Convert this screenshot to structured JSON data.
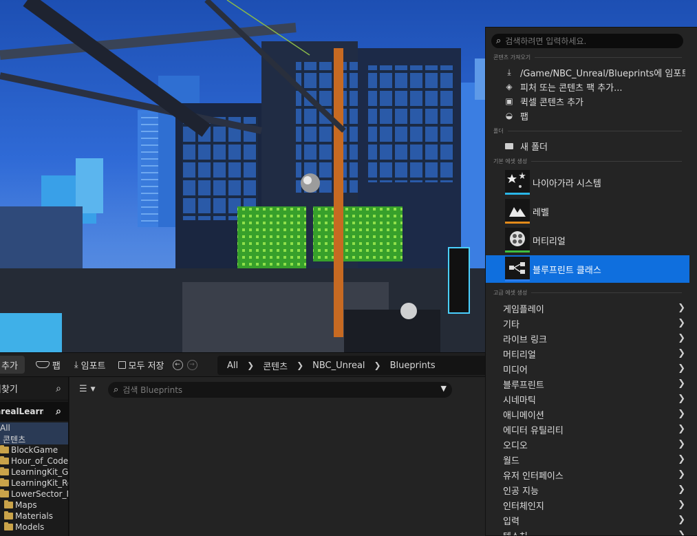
{
  "toolbar": {
    "add_label": "추가",
    "fab_label": "팹",
    "import_label": "임포트",
    "save_all_label": "모두 저장"
  },
  "breadcrumb": [
    "All",
    "콘텐츠",
    "NBC_Unreal",
    "Blueprints"
  ],
  "left_panel": {
    "header": "즐겨찾기",
    "project": "UnrealLearningKit",
    "tree": [
      {
        "label": "All",
        "folder": false,
        "selected": true
      },
      {
        "label": "콘텐츠",
        "folder": false,
        "selected": true
      },
      {
        "label": "BlockGame",
        "folder": true
      },
      {
        "label": "Hour_of_Code",
        "folder": true
      },
      {
        "label": "LearningKit_Ga",
        "folder": true
      },
      {
        "label": "LearningKit_Ro",
        "folder": true
      },
      {
        "label": "LowerSector_M",
        "folder": true
      },
      {
        "label": "Maps",
        "folder": true
      },
      {
        "label": "Materials",
        "folder": true
      },
      {
        "label": "Models",
        "folder": true
      }
    ]
  },
  "main": {
    "search_placeholder": "검색 Blueprints"
  },
  "menu": {
    "search_placeholder": "검색하려면 입력하세요.",
    "sections": {
      "import": "콘텐츠 가져오기",
      "folder": "폴더",
      "basic": "기본 에셋 생성",
      "advanced": "고급 에셋 생성"
    },
    "import_items": [
      {
        "label": "/Game/NBC_Unreal/Blueprints에 임포트...",
        "icon": "import-icon"
      },
      {
        "label": "피처 또는 콘텐츠 팩 추가...",
        "icon": "feature-pack-icon"
      },
      {
        "label": "퀵셀 콘텐츠 추가",
        "icon": "quixel-icon"
      },
      {
        "label": "팹",
        "icon": "fab-icon"
      }
    ],
    "folder_items": [
      {
        "label": "새 폴더",
        "icon": "new-folder-icon"
      }
    ],
    "basic_assets": [
      {
        "label": "나이아가라 시스템",
        "icon": "niagara-icon",
        "color": "#2ab6e8"
      },
      {
        "label": "레벨",
        "icon": "level-icon",
        "color": "#e38a1a"
      },
      {
        "label": "머티리얼",
        "icon": "material-icon",
        "color": "#3fbf3f"
      },
      {
        "label": "블루프린트 클래스",
        "icon": "blueprint-icon",
        "color": "#2a7ef0"
      }
    ],
    "advanced_items": [
      "게임플레이",
      "기타",
      "라이브 링크",
      "머티리얼",
      "미디어",
      "블루프린트",
      "시네마틱",
      "애니메이션",
      "에디터 유틸리티",
      "오디오",
      "월드",
      "유저 인터페이스",
      "인공 지능",
      "인터체인지",
      "입력",
      "텍스처"
    ]
  },
  "colors": {
    "highlight": "#0f6fde",
    "panel": "#242424",
    "folder": "#c9a34a"
  }
}
